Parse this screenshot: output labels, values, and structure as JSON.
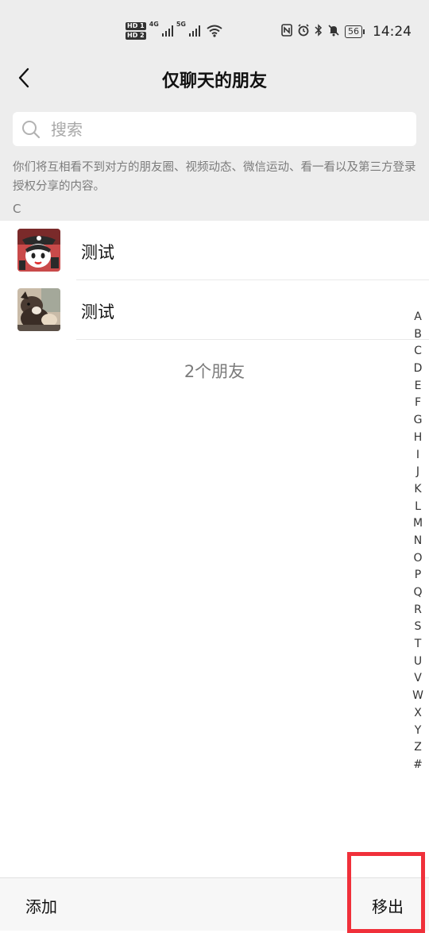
{
  "status_bar": {
    "sim1": "HD 1",
    "sim2": "HD 2",
    "network1": "4G",
    "network2": "5G",
    "battery": "56",
    "time": "14:24",
    "icons": [
      "nfc-icon",
      "alarm-icon",
      "bluetooth-icon",
      "mute-icon"
    ]
  },
  "header": {
    "title": "仅聊天的朋友",
    "back_icon": "chevron-left-icon"
  },
  "search": {
    "placeholder": "搜索"
  },
  "notice": "你们将互相看不到对方的朋友圈、视频动态、微信运动、看一看以及第三方登录授权分享的内容。",
  "section_letter": "C",
  "contacts": [
    {
      "name": "测试",
      "avatar": "cartoon-avatar"
    },
    {
      "name": "测试",
      "avatar": "cat-photo-avatar"
    }
  ],
  "friend_count": "2个朋友",
  "alphabet": [
    "A",
    "B",
    "C",
    "D",
    "E",
    "F",
    "G",
    "H",
    "I",
    "J",
    "K",
    "L",
    "M",
    "N",
    "O",
    "P",
    "Q",
    "R",
    "S",
    "T",
    "U",
    "V",
    "W",
    "X",
    "Y",
    "Z",
    "#"
  ],
  "bottom_bar": {
    "add_label": "添加",
    "remove_label": "移出"
  },
  "colors": {
    "header_bg": "#ededed",
    "highlight": "#f0303a"
  }
}
